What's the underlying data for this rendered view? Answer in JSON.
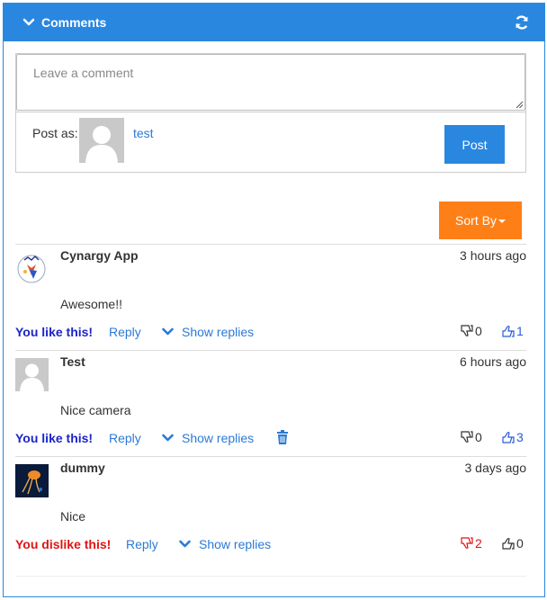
{
  "header": {
    "title": "Comments"
  },
  "composer": {
    "placeholder": "Leave a comment",
    "post_as_label": "Post as:",
    "username": "test",
    "post_label": "Post"
  },
  "sort": {
    "label": "Sort By"
  },
  "comments": [
    {
      "author": "Cynargy App",
      "time": "3 hours ago",
      "body": "Awesome!!",
      "reaction": "You like this!",
      "reply_label": "Reply",
      "show_replies_label": "Show replies",
      "dislikes": "0",
      "likes": "1"
    },
    {
      "author": "Test",
      "time": "6 hours ago",
      "body": "Nice camera",
      "reaction": "You like this!",
      "reply_label": "Reply",
      "show_replies_label": "Show replies",
      "dislikes": "0",
      "likes": "3"
    },
    {
      "author": "dummy",
      "time": "3 days ago",
      "body": "Nice",
      "reaction": "You dislike this!",
      "reply_label": "Reply",
      "show_replies_label": "Show replies",
      "dislikes": "2",
      "likes": "0"
    }
  ],
  "colors": {
    "primary": "#2a87e0",
    "sort_button": "#ff7f17",
    "liked": "#1c24c9",
    "disliked": "#e01414",
    "link": "#2a7ad6"
  }
}
